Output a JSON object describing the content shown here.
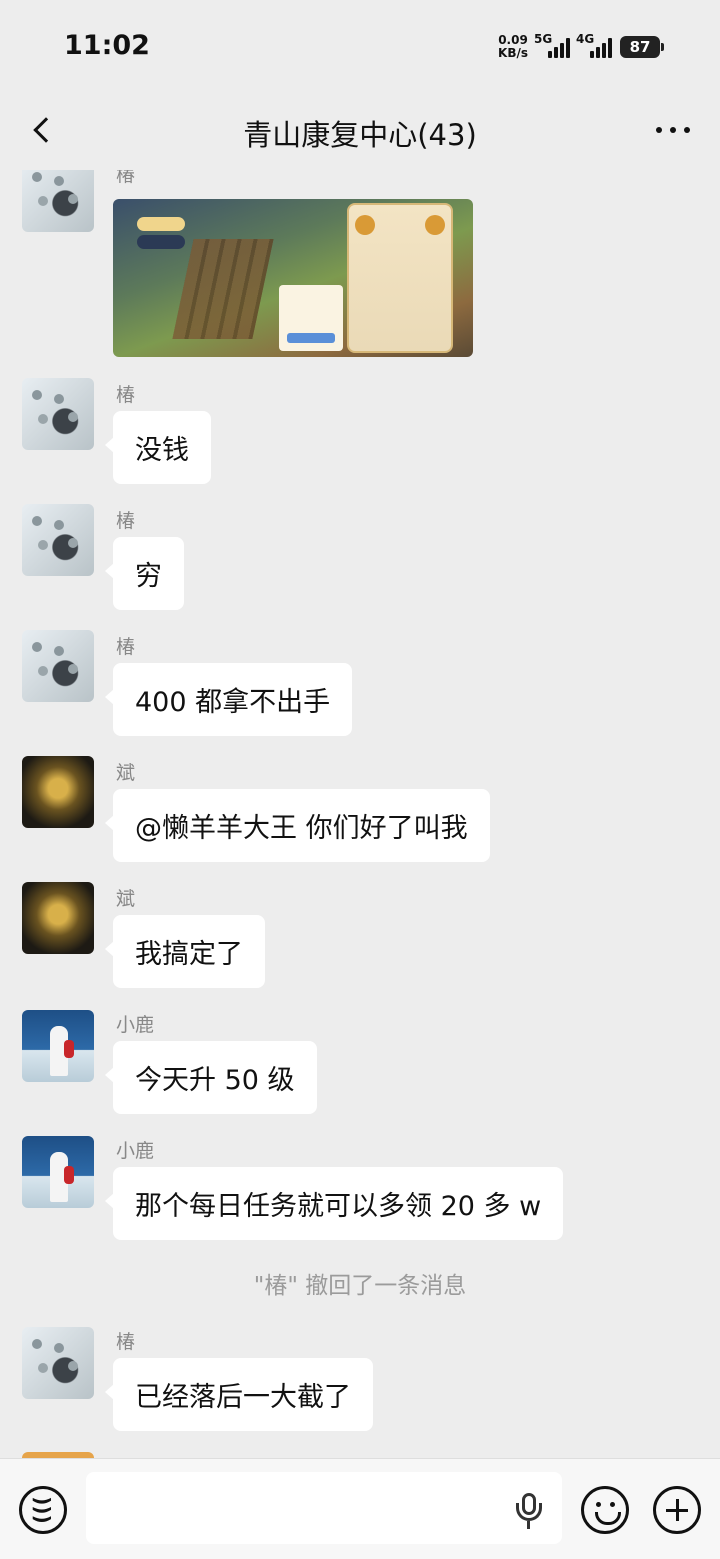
{
  "status": {
    "time": "11:02",
    "netspeed_value": "0.09",
    "netspeed_unit": "KB/s",
    "net1": "5G",
    "net2": "4G",
    "battery": "87"
  },
  "header": {
    "title": "青山康复中心(43)"
  },
  "messages": [
    {
      "sender": "椿",
      "type": "image",
      "avatar": "cat-paw-avatar"
    },
    {
      "sender": "椿",
      "type": "text",
      "text": "没钱",
      "avatar": "cat-paw-avatar"
    },
    {
      "sender": "椿",
      "type": "text",
      "text": "穷",
      "avatar": "cat-paw-avatar"
    },
    {
      "sender": "椿",
      "type": "text",
      "text": "400 都拿不出手",
      "avatar": "cat-paw-avatar"
    },
    {
      "sender": "斌",
      "type": "text",
      "text": "@懒羊羊大王  你们好了叫我",
      "avatar": "golden-armor-avatar"
    },
    {
      "sender": "斌",
      "type": "text",
      "text": "我搞定了",
      "avatar": "golden-armor-avatar"
    },
    {
      "sender": "小鹿",
      "type": "text",
      "text": "今天升 50 级",
      "avatar": "seaside-girl-avatar"
    },
    {
      "sender": "小鹿",
      "type": "text",
      "text": "那个每日任务就可以多领 20 多 w",
      "avatar": "seaside-girl-avatar"
    },
    {
      "type": "system",
      "text": "\"椿\" 撤回了一条消息"
    },
    {
      "sender": "椿",
      "type": "text",
      "text": "已经落后一大截了",
      "avatar": "cat-paw-avatar"
    }
  ],
  "input": {
    "placeholder": ""
  },
  "icons": {
    "back": "back-arrow-icon",
    "more": "more-dots-icon",
    "voice": "voice-icon",
    "mic": "microphone-icon",
    "emoji": "emoji-icon",
    "plus": "plus-icon"
  }
}
